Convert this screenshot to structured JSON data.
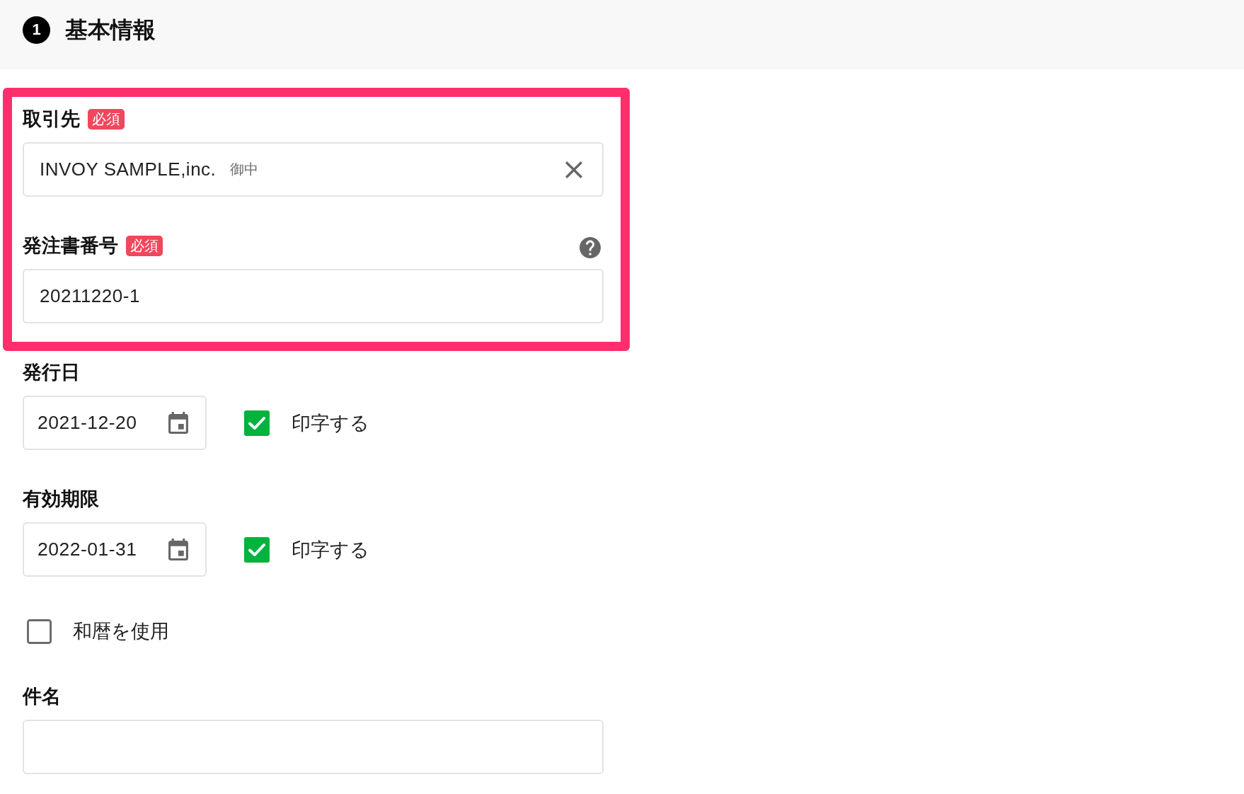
{
  "section": {
    "number": "1",
    "title": "基本情報"
  },
  "fields": [
    {
      "kind": "text",
      "label": "取引先",
      "badge": "必須",
      "value": "INVOY SAMPLE,inc.",
      "suffix": "御中",
      "clear_button": true,
      "help": false,
      "highlighted": true
    },
    {
      "kind": "text",
      "label": "発注書番号",
      "badge": "必須",
      "value": "20211220-1",
      "clear_button": false,
      "help": true,
      "highlighted": true
    },
    {
      "kind": "date",
      "label": "発行日",
      "value": "2021-12-20",
      "print_option": {
        "label": "印字する",
        "checked": true
      },
      "highlighted": false
    },
    {
      "kind": "date",
      "label": "有効期限",
      "value": "2022-01-31",
      "print_option": {
        "label": "印字する",
        "checked": true
      },
      "highlighted": false
    },
    {
      "kind": "checkbox",
      "label": "和暦を使用",
      "checked": false,
      "highlighted": false
    },
    {
      "kind": "text",
      "label": "件名",
      "clear_button": false,
      "help": false,
      "highlighted": false
    }
  ]
}
